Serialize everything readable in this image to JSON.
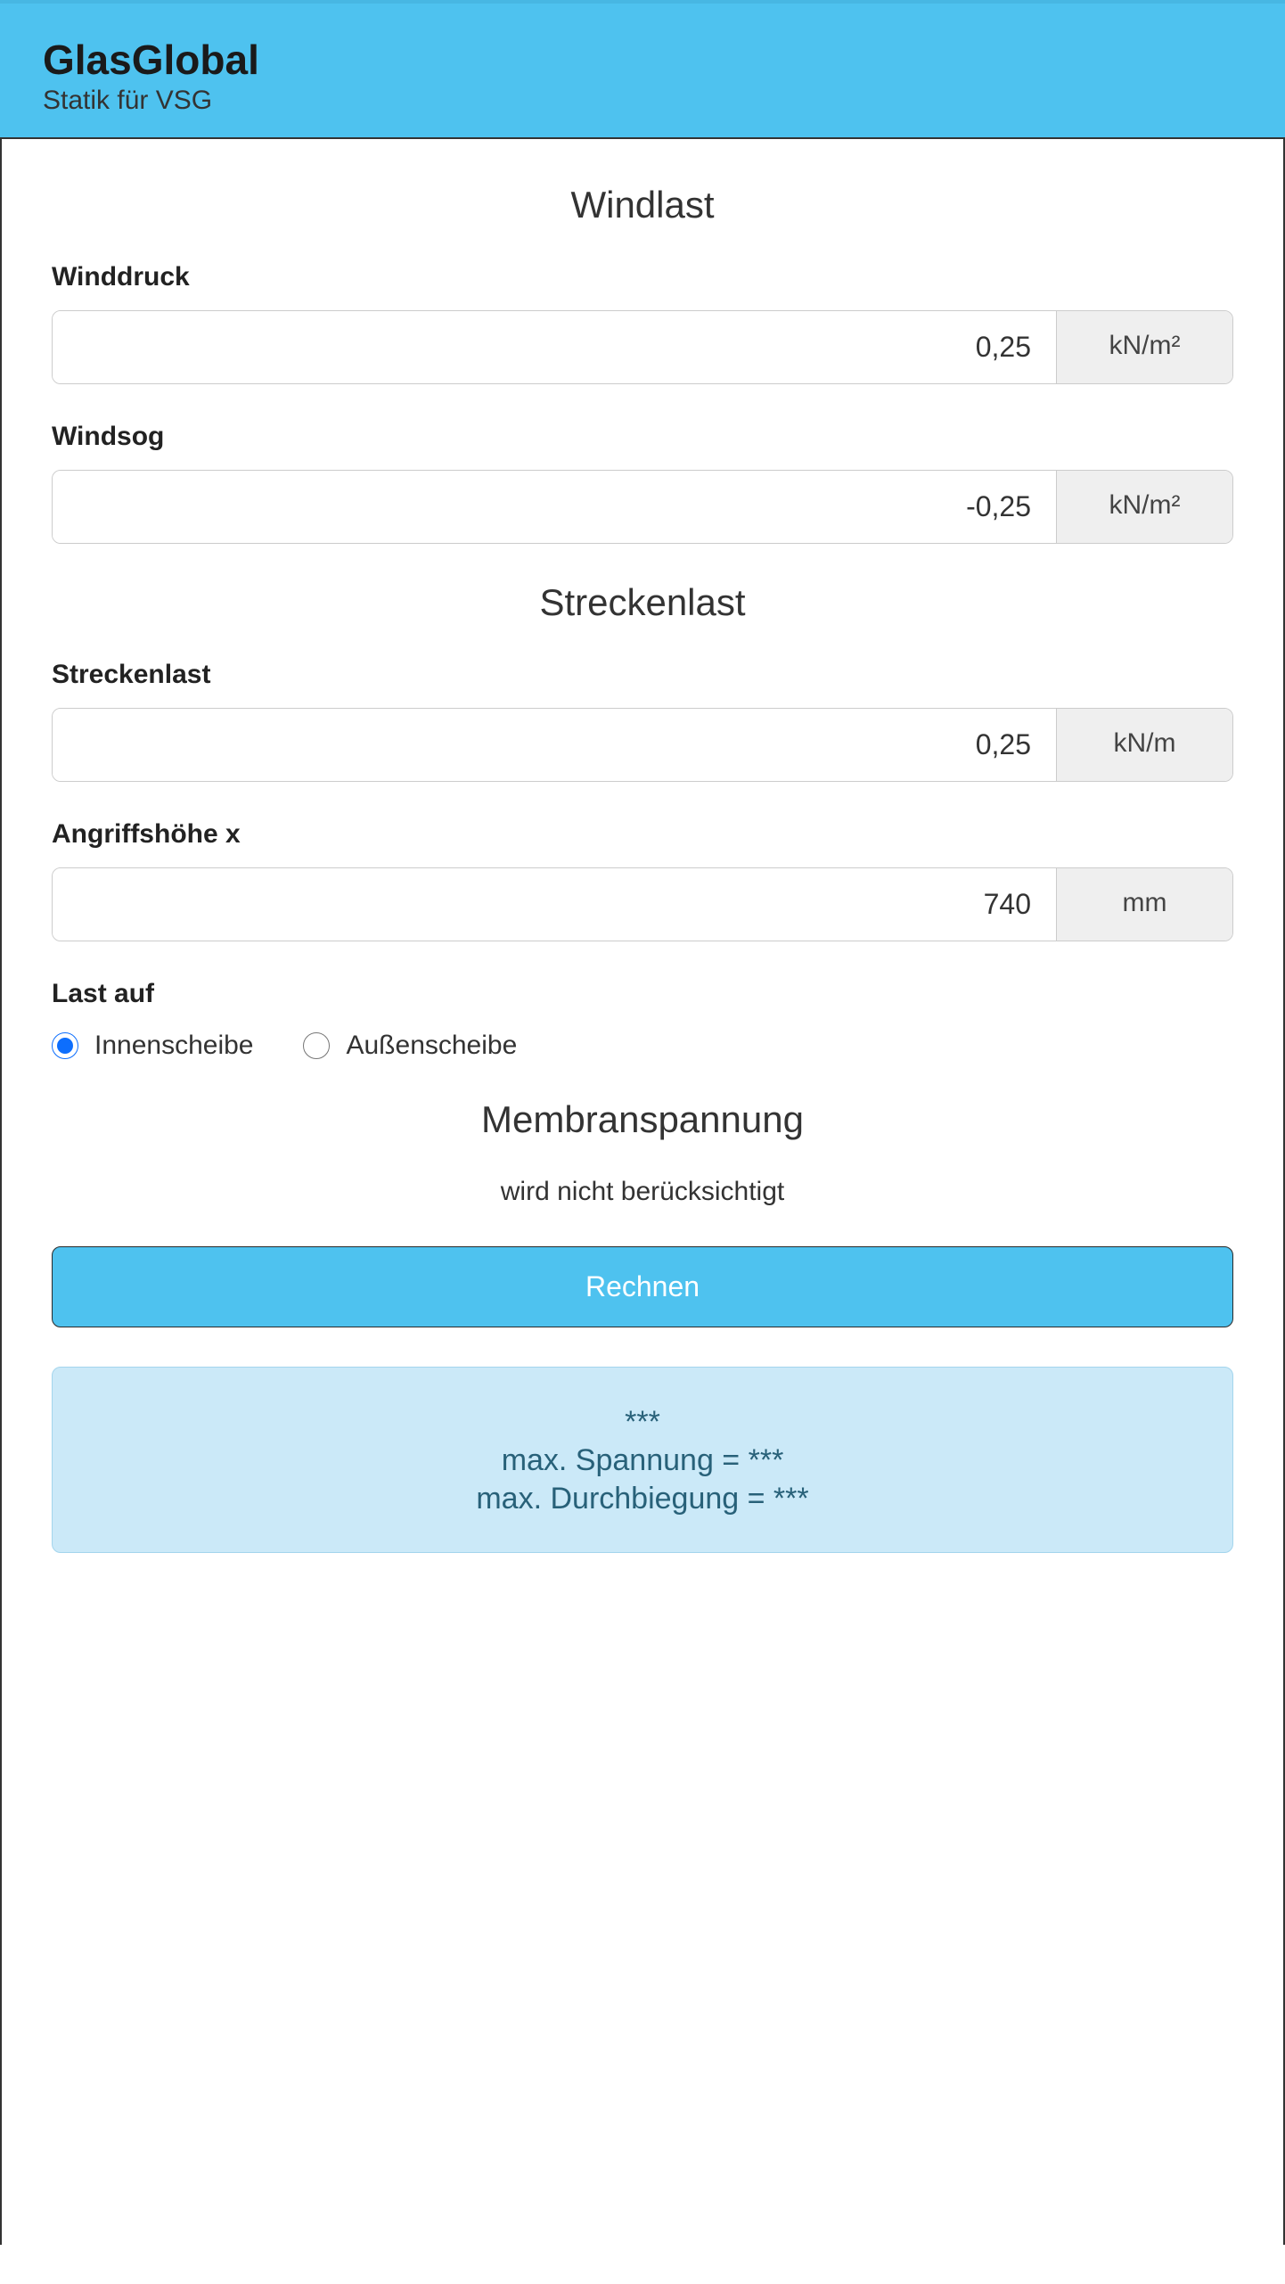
{
  "header": {
    "title": "GlasGlobal",
    "subtitle": "Statik für VSG"
  },
  "sections": {
    "windlast": {
      "heading": "Windlast",
      "winddruck": {
        "label": "Winddruck",
        "value": "0,25",
        "unit": "kN/m²"
      },
      "windsog": {
        "label": "Windsog",
        "value": "-0,25",
        "unit": "kN/m²"
      }
    },
    "streckenlast": {
      "heading": "Streckenlast",
      "streckenlast": {
        "label": "Streckenlast",
        "value": "0,25",
        "unit": "kN/m"
      },
      "angriffshoehe": {
        "label": "Angriffshöhe x",
        "value": "740",
        "unit": "mm"
      },
      "lastAuf": {
        "label": "Last auf",
        "option1": "Innenscheibe",
        "option2": "Außenscheibe",
        "selected": "Innenscheibe"
      }
    },
    "membranspannung": {
      "heading": "Membranspannung",
      "note": "wird nicht berücksichtigt"
    }
  },
  "actions": {
    "calculate": "Rechnen"
  },
  "results": {
    "line1": "***",
    "line2": "max. Spannung = ***",
    "line3": "max. Durchbiegung = ***"
  }
}
